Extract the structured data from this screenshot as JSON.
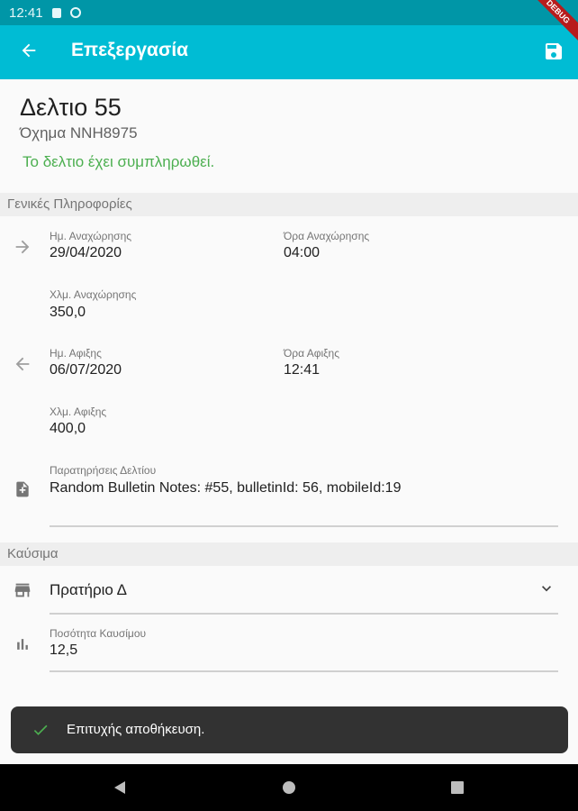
{
  "status_bar": {
    "time": "12:41"
  },
  "app_bar": {
    "title": "Επεξεργασία",
    "debug_banner": "DEBUG"
  },
  "bulletin": {
    "title": "Δελτιο 55",
    "vehicle": "Όχημα ΝΝΗ8975",
    "status_message": "Το δελτιο έχει συμπληρωθεί."
  },
  "general_info": {
    "header": "Γενικές Πληροφορίες",
    "departure_date_label": "Ημ. Αναχώρησης",
    "departure_date": "29/04/2020",
    "departure_time_label": "Όρα Αναχώρησης",
    "departure_time": "04:00",
    "departure_km_label": "Χλμ. Αναχώρησης",
    "departure_km": "350,0",
    "arrival_date_label": "Ημ. Αφιξης",
    "arrival_date": "06/07/2020",
    "arrival_time_label": "Όρα Αφιξης",
    "arrival_time": "12:41",
    "arrival_km_label": "Χλμ. Αφιξης",
    "arrival_km": "400,0",
    "notes_label": "Παρατηρήσεις Δελτίου",
    "notes": "Random Bulletin Notes: #55, bulletinId: 56, mobileId:19"
  },
  "fuel": {
    "header": "Καύσιμα",
    "station": "Πρατήριο Δ",
    "quantity_label": "Ποσότητα Καυσίμου",
    "quantity": "12,5"
  },
  "snackbar": {
    "message": "Επιτυχής αποθήκευση."
  },
  "colors": {
    "primary": "#00bcd4",
    "primary_dark": "#0096a7",
    "success": "#4caf50",
    "snackbar": "#323232"
  },
  "icons": {
    "back": "arrow-back-icon",
    "save": "save-icon",
    "departure": "arrow-forward-icon",
    "arrival": "arrow-back-icon",
    "notes": "note-add-icon",
    "station": "store-icon",
    "quantity": "bar-chart-icon",
    "dropdown": "chevron-down-icon",
    "success": "check-icon"
  }
}
